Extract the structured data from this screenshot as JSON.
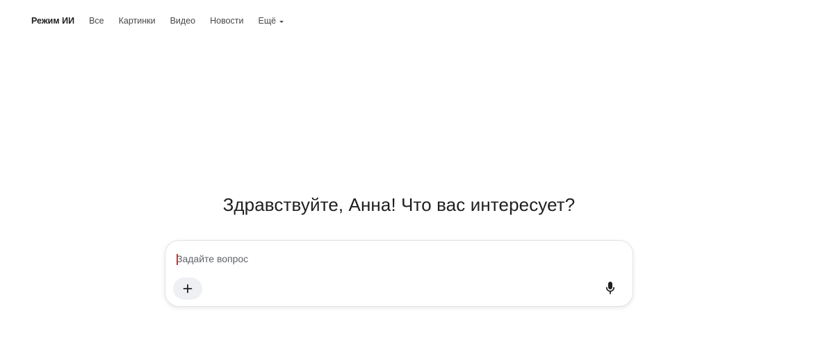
{
  "nav": {
    "tabs": [
      {
        "label": "Режим ИИ",
        "active": true
      },
      {
        "label": "Все"
      },
      {
        "label": "Картинки"
      },
      {
        "label": "Видео"
      },
      {
        "label": "Новости"
      },
      {
        "label": "Ещё"
      }
    ],
    "more_icon": "chevron-down-icon"
  },
  "greeting": "Здравствуйте, Анна! Что вас интересует?",
  "search": {
    "placeholder": "Задайте вопрос",
    "value": "",
    "add_icon": "plus-icon",
    "voice_icon": "microphone-icon"
  },
  "colors": {
    "caret": "#d93025",
    "text": "#1f1f1f",
    "muted": "#474747",
    "pill_bg": "#eef0f4"
  }
}
